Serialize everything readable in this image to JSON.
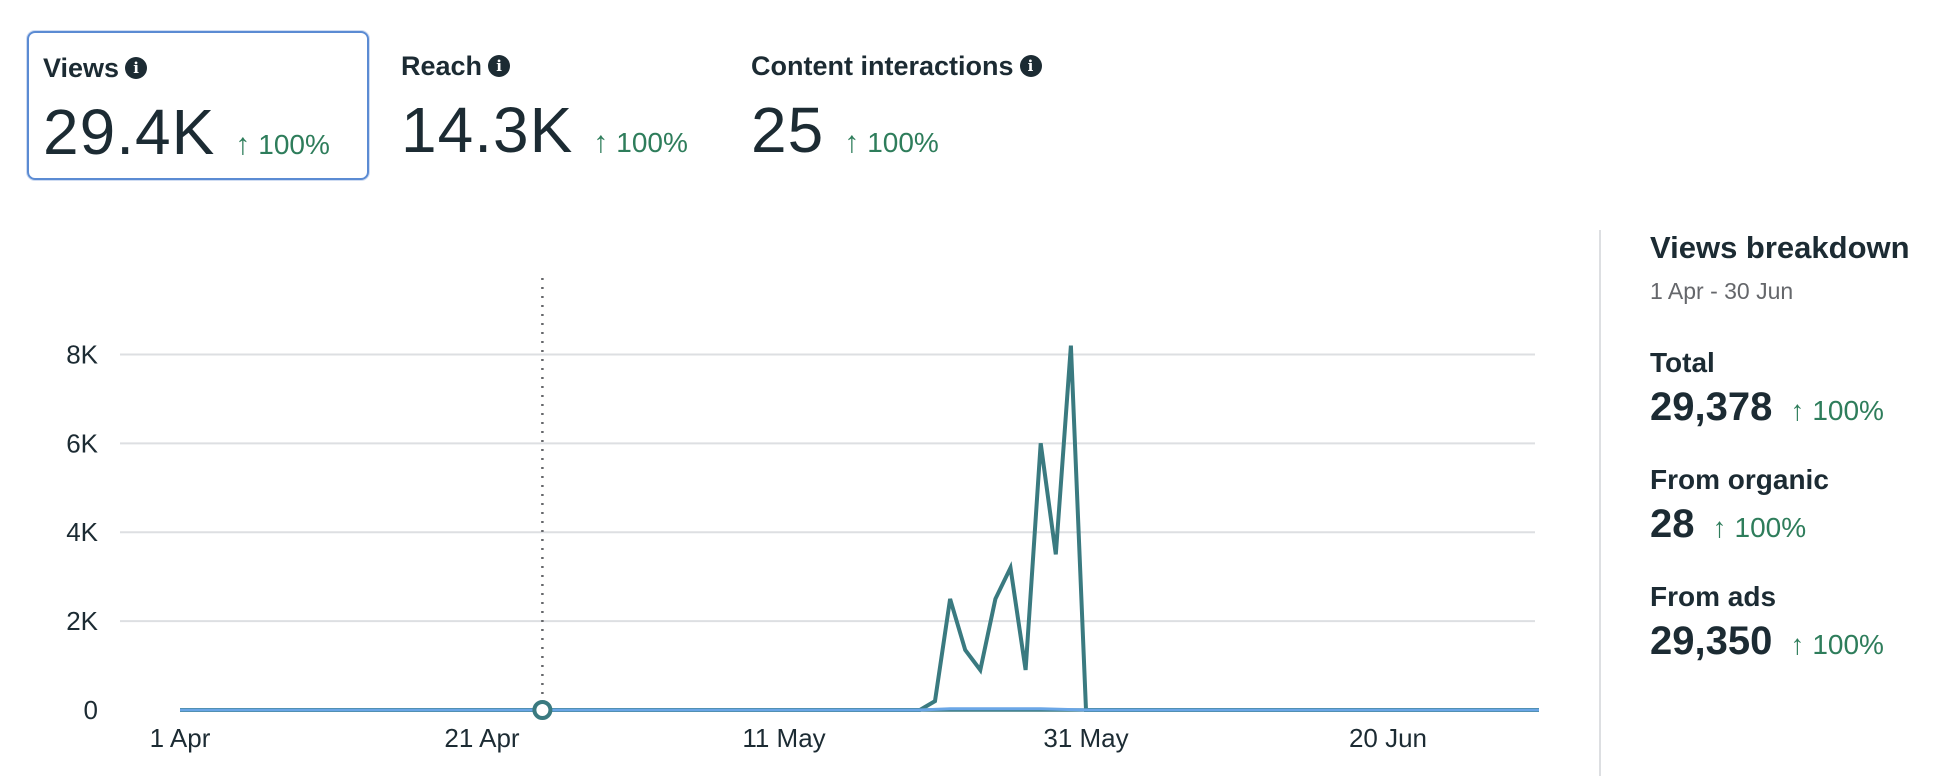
{
  "metrics": [
    {
      "label": "Views",
      "value": "29.4K",
      "change": "100%",
      "selected": true
    },
    {
      "label": "Reach",
      "value": "14.3K",
      "change": "100%",
      "selected": false
    },
    {
      "label": "Content interactions",
      "value": "25",
      "change": "100%",
      "selected": false
    }
  ],
  "icons": {
    "info": "info-icon",
    "arrow": "arrow-up-icon"
  },
  "arrow_glyph": "↑",
  "info_glyph": "i",
  "colors": {
    "line": "#3a7a80",
    "line_secondary": "#6aa6e6",
    "positive": "#2e7d5b",
    "selected_border": "#5b8bd3",
    "grid": "#dddfe2"
  },
  "breakdown": {
    "title": "Views breakdown",
    "range": "1 Apr - 30 Jun",
    "items": [
      {
        "label": "Total",
        "value": "29,378",
        "change": "100%"
      },
      {
        "label": "From organic",
        "value": "28",
        "change": "100%"
      },
      {
        "label": "From ads",
        "value": "29,350",
        "change": "100%"
      }
    ]
  },
  "chart_data": {
    "type": "line",
    "x_ticks": [
      "1 Apr",
      "21 Apr",
      "11 May",
      "31 May",
      "20 Jun"
    ],
    "y_ticks": [
      "0",
      "2K",
      "4K",
      "6K",
      "8K"
    ],
    "ylim": [
      0,
      9000
    ],
    "grid": true,
    "hover_date": "25 Apr",
    "series": [
      {
        "points": [
          [
            "1 Apr",
            0
          ],
          [
            "25 Apr",
            0
          ],
          [
            "20 May",
            0
          ],
          [
            "21 May",
            200
          ],
          [
            "22 May",
            2500
          ],
          [
            "23 May",
            1350
          ],
          [
            "24 May",
            900
          ],
          [
            "25 May",
            2500
          ],
          [
            "26 May",
            3200
          ],
          [
            "27 May",
            900
          ],
          [
            "28 May",
            6000
          ],
          [
            "29 May",
            3500
          ],
          [
            "30 May",
            8200
          ],
          [
            "31 May",
            0
          ],
          [
            "30 Jun",
            0
          ]
        ]
      },
      {
        "points": [
          [
            "1 Apr",
            0
          ],
          [
            "20 May",
            0
          ],
          [
            "22 May",
            30
          ],
          [
            "28 May",
            30
          ],
          [
            "31 May",
            0
          ],
          [
            "30 Jun",
            0
          ]
        ]
      }
    ]
  }
}
